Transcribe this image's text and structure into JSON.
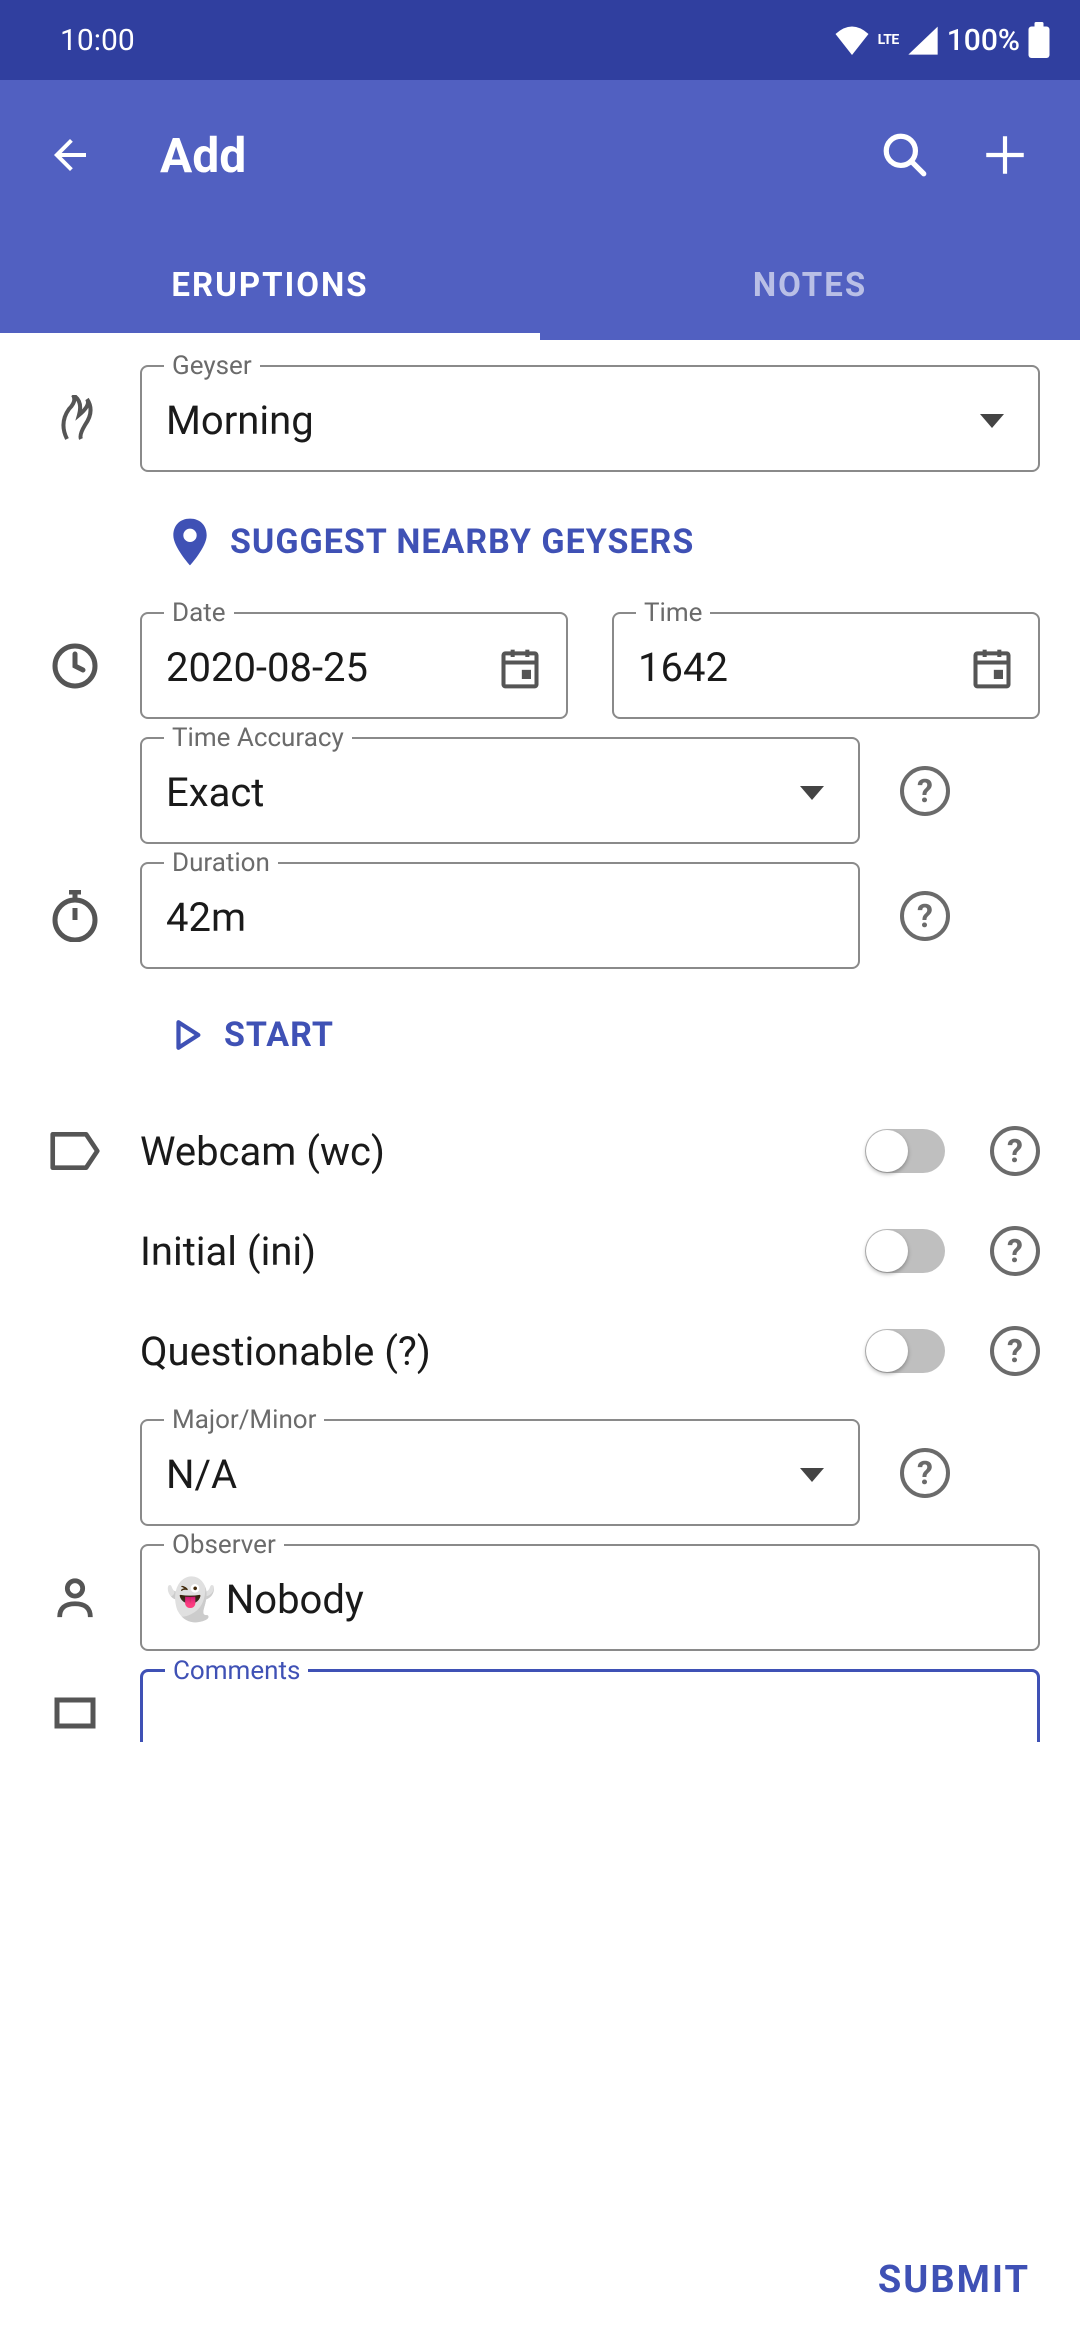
{
  "status": {
    "time": "10:00",
    "network": "LTE",
    "battery": "100%"
  },
  "header": {
    "title": "Add"
  },
  "tabs": {
    "eruptions": "ERUPTIONS",
    "notes": "NOTES",
    "active": "eruptions"
  },
  "form": {
    "geyser": {
      "label": "Geyser",
      "value": "Morning"
    },
    "suggest": "SUGGEST NEARBY GEYSERS",
    "date": {
      "label": "Date",
      "value": "2020-08-25"
    },
    "time": {
      "label": "Time",
      "value": "1642"
    },
    "timeAccuracy": {
      "label": "Time Accuracy",
      "value": "Exact"
    },
    "duration": {
      "label": "Duration",
      "value": "42m"
    },
    "start": "START",
    "toggles": {
      "webcam": {
        "label": "Webcam (wc)",
        "on": false
      },
      "initial": {
        "label": "Initial (ini)",
        "on": false
      },
      "questionable": {
        "label": "Questionable (?)",
        "on": false
      }
    },
    "majorMinor": {
      "label": "Major/Minor",
      "value": "N/A"
    },
    "observer": {
      "label": "Observer",
      "value": "👻 Nobody"
    },
    "comments": {
      "label": "Comments",
      "value": ""
    }
  },
  "submit": "SUBMIT"
}
